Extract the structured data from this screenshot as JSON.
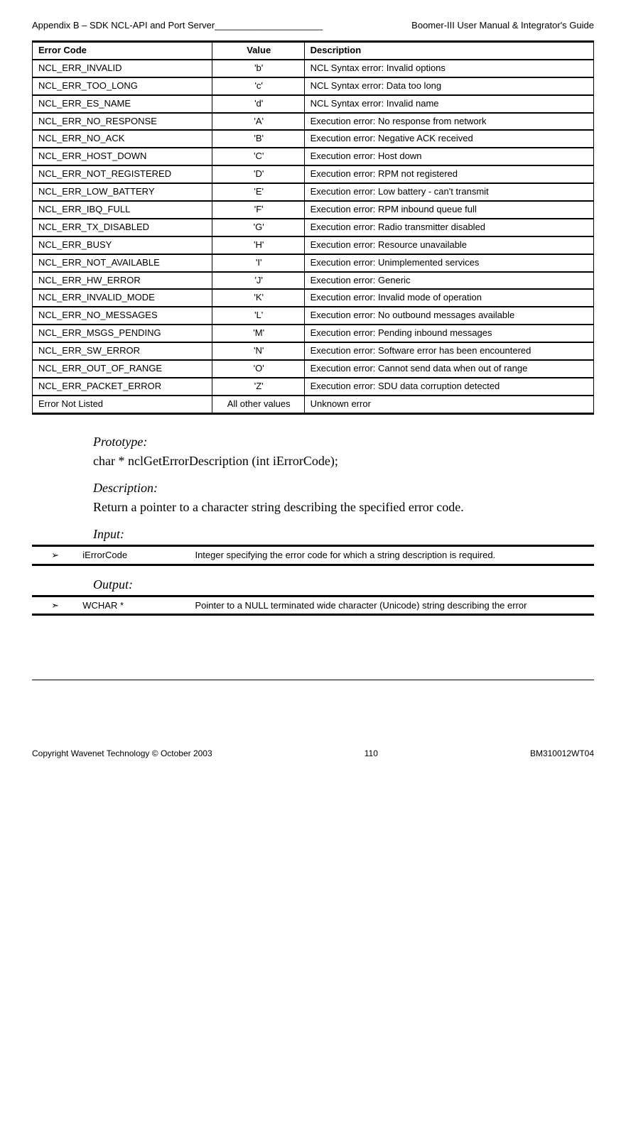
{
  "header": {
    "left": "Appendix B – SDK NCL-API and Port Server_____________________",
    "right": "Boomer-III User Manual & Integrator's Guide"
  },
  "error_table": {
    "cols": [
      "Error Code",
      "Value",
      "Description"
    ],
    "rows": [
      [
        "NCL_ERR_INVALID",
        "'b'",
        "NCL Syntax error: Invalid options"
      ],
      [
        "NCL_ERR_TOO_LONG",
        "'c'",
        "NCL Syntax error: Data too long"
      ],
      [
        "NCL_ERR_ES_NAME",
        "'d'",
        "NCL Syntax error: Invalid name"
      ],
      [
        "NCL_ERR_NO_RESPONSE",
        "'A'",
        "Execution error: No response from network"
      ],
      [
        "NCL_ERR_NO_ACK",
        "'B'",
        "Execution error: Negative ACK received"
      ],
      [
        "NCL_ERR_HOST_DOWN",
        "'C'",
        "Execution error: Host down"
      ],
      [
        "NCL_ERR_NOT_REGISTERED",
        "'D'",
        "Execution error: RPM not registered"
      ],
      [
        "NCL_ERR_LOW_BATTERY",
        "'E'",
        "Execution error: Low battery - can't transmit"
      ],
      [
        "NCL_ERR_IBQ_FULL",
        "'F'",
        "Execution error: RPM inbound queue full"
      ],
      [
        "NCL_ERR_TX_DISABLED",
        "'G'",
        "Execution error: Radio transmitter disabled"
      ],
      [
        "NCL_ERR_BUSY",
        "'H'",
        "Execution error: Resource unavailable"
      ],
      [
        "NCL_ERR_NOT_AVAILABLE",
        "'I'",
        "Execution error: Unimplemented services"
      ],
      [
        "NCL_ERR_HW_ERROR",
        "'J'",
        "Execution error: Generic"
      ],
      [
        "NCL_ERR_INVALID_MODE",
        "'K'",
        "Execution error: Invalid mode of operation"
      ],
      [
        "NCL_ERR_NO_MESSAGES",
        "'L'",
        "Execution error: No outbound messages available"
      ],
      [
        "NCL_ERR_MSGS_PENDING",
        "'M'",
        "Execution error: Pending inbound messages"
      ],
      [
        "NCL_ERR_SW_ERROR",
        "'N'",
        "Execution error: Software error has been encountered"
      ],
      [
        "NCL_ERR_OUT_OF_RANGE",
        "'O'",
        "Execution error: Cannot send data when out of range"
      ],
      [
        "NCL_ERR_PACKET_ERROR",
        "'Z'",
        "Execution error: SDU data corruption detected"
      ],
      [
        "Error Not Listed",
        "All other values",
        "Unknown error"
      ]
    ]
  },
  "sections": {
    "prototype": {
      "label": "Prototype:",
      "text": "char * nclGetErrorDescription (int iErrorCode);"
    },
    "description": {
      "label": "Description:",
      "text": "Return a pointer to a character string describing the specified error code."
    },
    "input": {
      "label": "Input:",
      "rows": [
        [
          "➢",
          "iErrorCode",
          "Integer specifying the error code for which a string description is required."
        ]
      ]
    },
    "output": {
      "label": "Output:",
      "rows": [
        [
          "➣",
          "WCHAR *",
          "Pointer to a NULL terminated wide character (Unicode) string describing the error"
        ]
      ]
    }
  },
  "footer": {
    "left": "Copyright Wavenet Technology © October 2003",
    "center": "110",
    "right": "BM310012WT04"
  }
}
